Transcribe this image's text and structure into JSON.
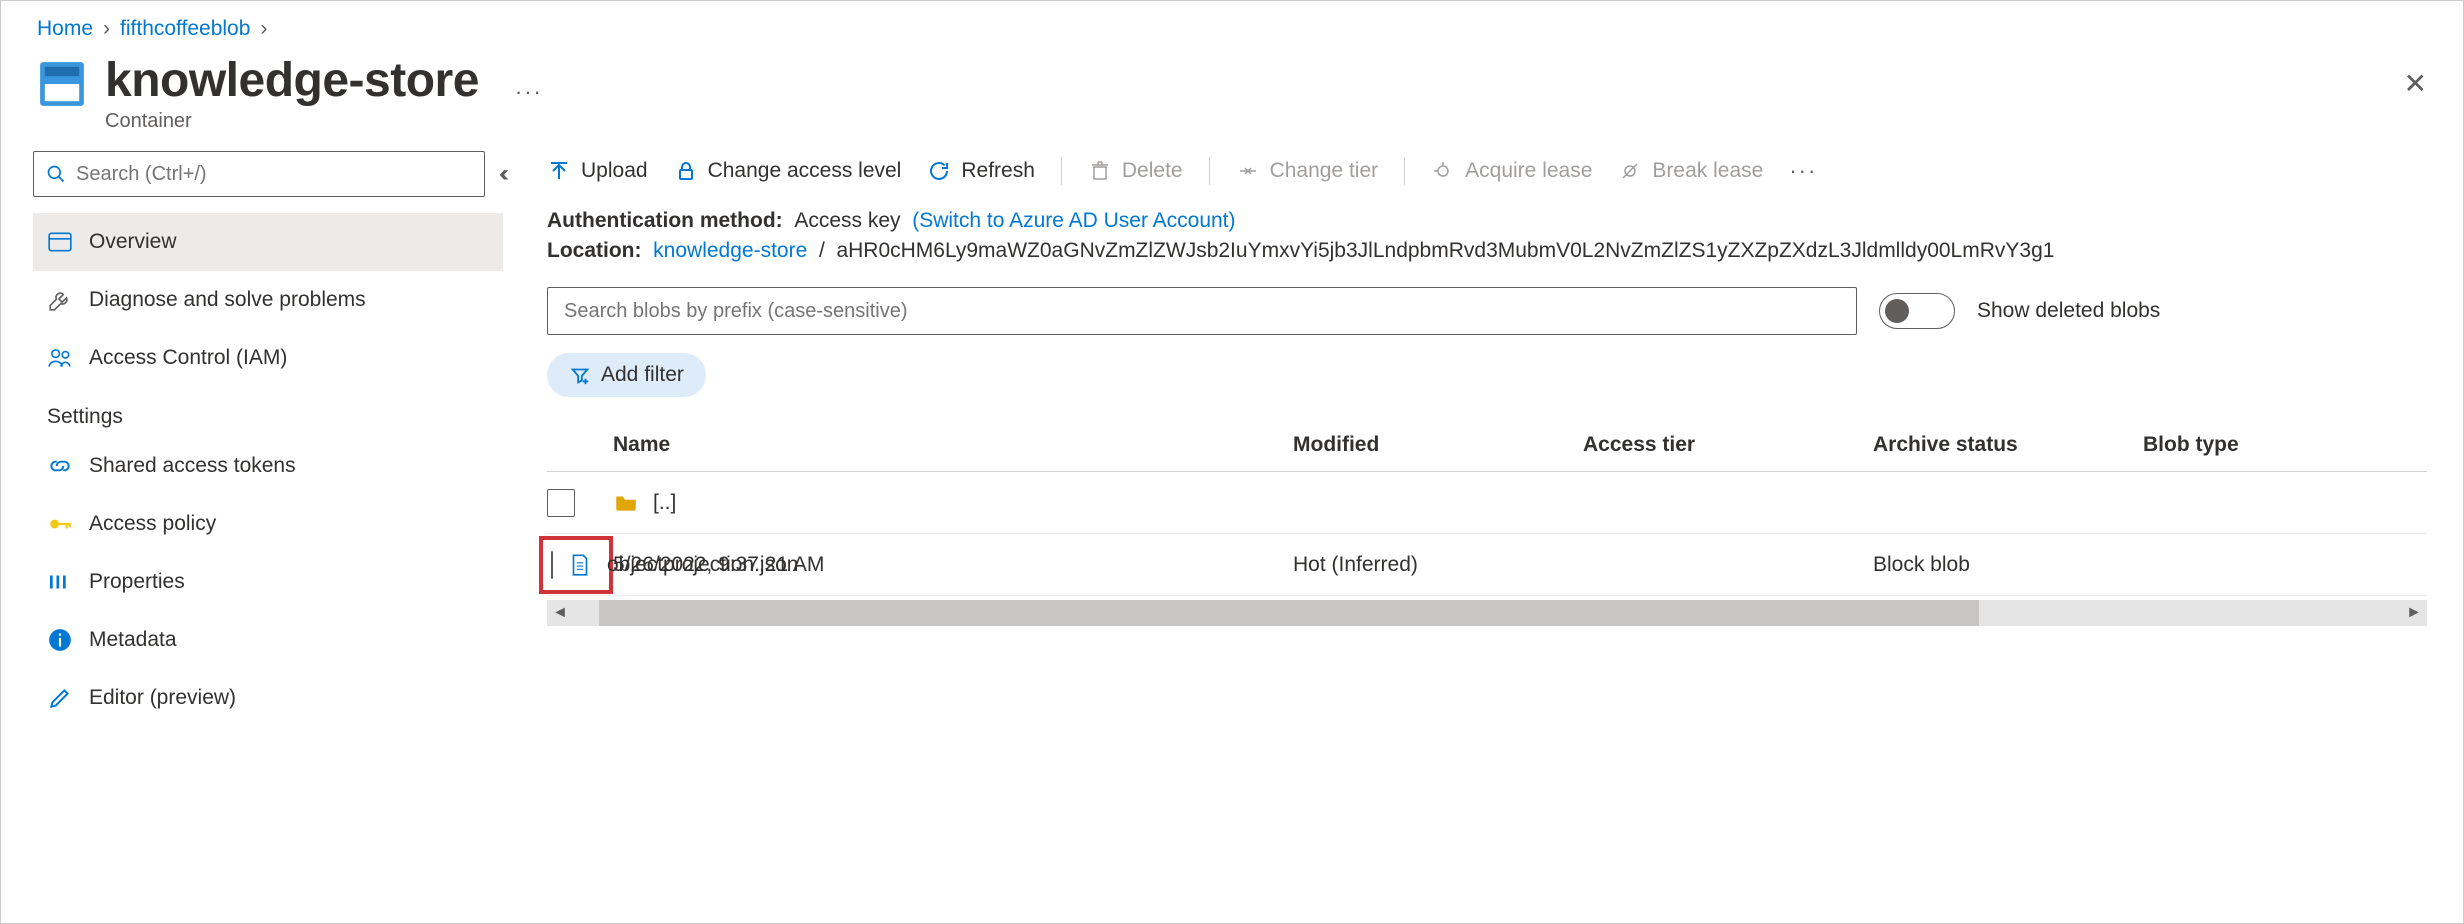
{
  "breadcrumb": {
    "home": "Home",
    "storage": "fifthcoffeeblob"
  },
  "header": {
    "title": "knowledge-store",
    "subtitle": "Container"
  },
  "sidebar": {
    "search_placeholder": "Search (Ctrl+/)",
    "items": {
      "overview": "Overview",
      "diagnose": "Diagnose and solve problems",
      "iam": "Access Control (IAM)"
    },
    "section": "Settings",
    "settings": {
      "sas": "Shared access tokens",
      "policy": "Access policy",
      "props": "Properties",
      "meta": "Metadata",
      "editor": "Editor (preview)"
    }
  },
  "toolbar": {
    "upload": "Upload",
    "access": "Change access level",
    "refresh": "Refresh",
    "delete": "Delete",
    "tier": "Change tier",
    "acquire": "Acquire lease",
    "break": "Break lease"
  },
  "info": {
    "auth_label": "Authentication method:",
    "auth_value": "Access key",
    "auth_link": "(Switch to Azure AD User Account)",
    "loc_label": "Location:",
    "loc_link": "knowledge-store",
    "loc_sep": "/",
    "loc_path": "aHR0cHM6Ly9maWZ0aGNvZmZlZWJsb2IuYmxvYi5jb3JlLndpbmRvd3MubmV0L2NvZmZlZS1yZXZpZXdzL3Jldmlldy00LmRvY3g1"
  },
  "search": {
    "placeholder": "Search blobs by prefix (case-sensitive)",
    "toggle": "Show deleted blobs"
  },
  "filter": {
    "add": "Add filter"
  },
  "table": {
    "cols": {
      "name": "Name",
      "modified": "Modified",
      "tier": "Access tier",
      "archive": "Archive status",
      "type": "Blob type"
    },
    "rows": [
      {
        "name": "[..]",
        "modified": "",
        "tier": "",
        "archive": "",
        "type": "",
        "kind": "folder"
      },
      {
        "name": "objectprojection.json",
        "modified": "5/26/2022, 9:37:21 AM",
        "tier": "Hot (Inferred)",
        "archive": "",
        "type": "Block blob",
        "kind": "file",
        "highlight": true
      }
    ]
  }
}
